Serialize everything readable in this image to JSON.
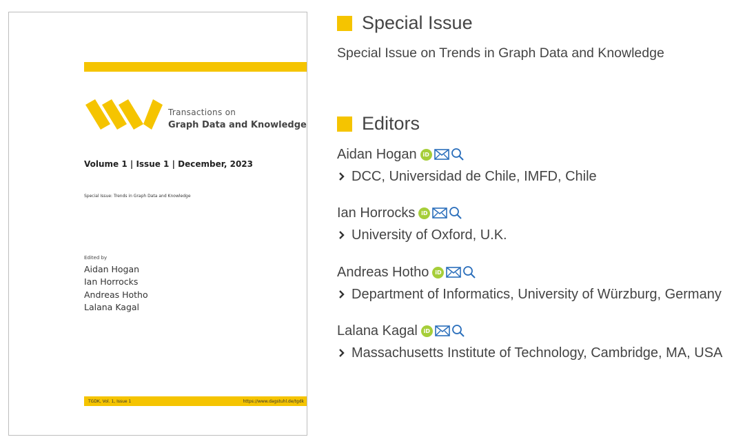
{
  "cover": {
    "series_line1": "Transactions on",
    "series_line2": "Graph Data and Knowledge",
    "volume_line": "Volume 1 | Issue 1 | December, 2023",
    "subtitle": "Special Issue: Trends in Graph Data and Knowledge",
    "edited_by": "Edited by",
    "editors": [
      "Aidan Hogan",
      "Ian Horrocks",
      "Andreas Hotho",
      "Lalana Kagal"
    ],
    "footer_left": "TGDK, Vol. 1, Issue 1",
    "footer_right": "https://www.dagstuhl.de/tgdk"
  },
  "special_issue": {
    "heading": "Special Issue",
    "description": "Special Issue on Trends in Graph Data and Knowledge"
  },
  "editors_section": {
    "heading": "Editors",
    "items": [
      {
        "name": "Aidan Hogan",
        "affiliation": "DCC, Universidad de Chile, IMFD, Chile"
      },
      {
        "name": "Ian Horrocks",
        "affiliation": "University of Oxford, U.K."
      },
      {
        "name": "Andreas Hotho",
        "affiliation": "Department of Informatics, University of Würzburg, Germany"
      },
      {
        "name": "Lalana Kagal",
        "affiliation": "Massachusetts Institute of Technology, Cambridge, MA, USA"
      }
    ]
  },
  "icons": {
    "orcid": "orcid-icon",
    "email": "envelope-icon",
    "search": "search-icon",
    "chevron": "chevron-right-icon"
  },
  "colors": {
    "accent": "#f5c400",
    "orcid": "#a6ce39",
    "link_icon": "#2a6ebb",
    "text": "#444444"
  },
  "orcid_badge": "iD"
}
